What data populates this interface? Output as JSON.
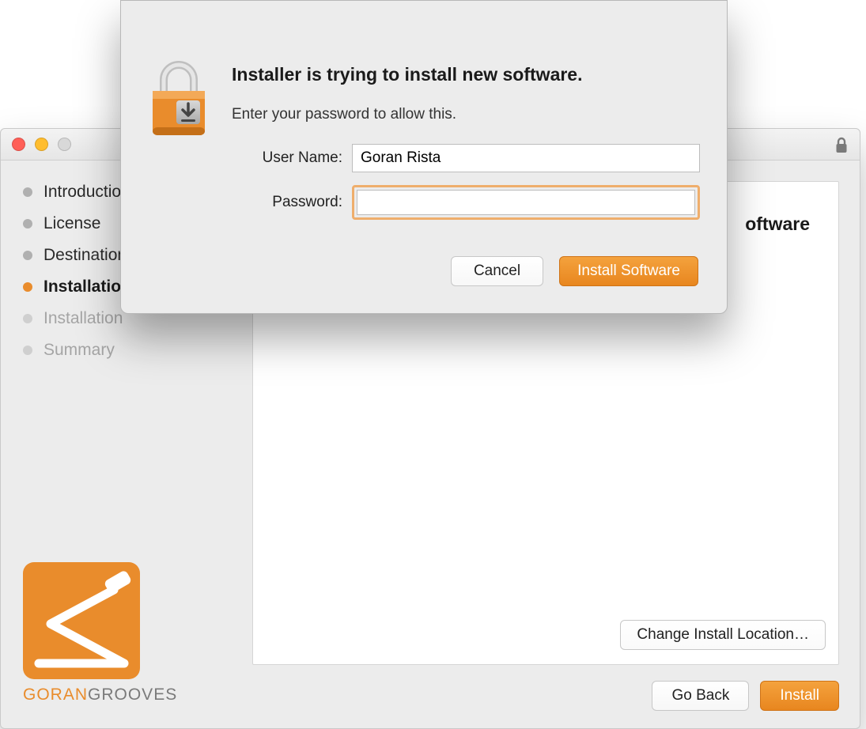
{
  "installer": {
    "steps": [
      {
        "label": "Introduction",
        "state": "done"
      },
      {
        "label": "License",
        "state": "done"
      },
      {
        "label": "Destination Select",
        "state": "done"
      },
      {
        "label": "Installation Type",
        "state": "active"
      },
      {
        "label": "Installation",
        "state": "disabled"
      },
      {
        "label": "Summary",
        "state": "disabled"
      }
    ],
    "content_heading_fragment": "oftware",
    "change_location_label": "Change Install Location…",
    "go_back_label": "Go Back",
    "install_label": "Install",
    "brand": {
      "prefix": "GORAN",
      "suffix": "GROOVES"
    }
  },
  "auth": {
    "title": "Installer is trying to install new software.",
    "subtitle": "Enter your password to allow this.",
    "username_label": "User Name:",
    "username_value": "Goran Rista",
    "password_label": "Password:",
    "password_value": "",
    "cancel_label": "Cancel",
    "install_label": "Install Software"
  }
}
